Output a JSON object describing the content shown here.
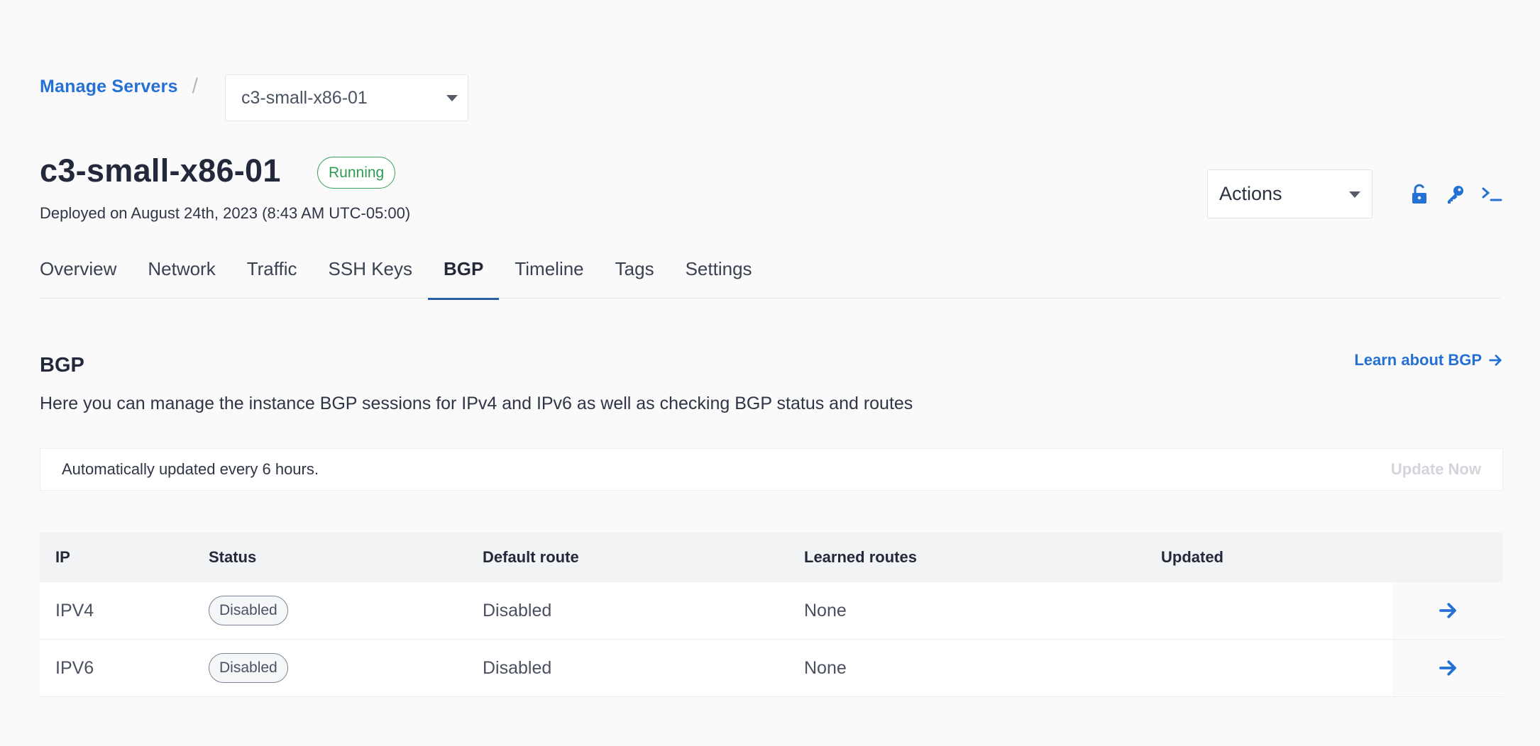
{
  "breadcrumb": {
    "link": "Manage Servers",
    "separator": "/",
    "server_select": "c3-small-x86-01"
  },
  "header": {
    "title": "c3-small-x86-01",
    "status": "Running",
    "deployed": "Deployed on August 24th, 2023 (8:43 AM UTC-05:00)",
    "actions": "Actions"
  },
  "toolbar": {
    "icons": [
      "unlock-icon",
      "key-icon",
      "terminal-icon"
    ]
  },
  "tabs": [
    {
      "label": "Overview",
      "active": false
    },
    {
      "label": "Network",
      "active": false
    },
    {
      "label": "Traffic",
      "active": false
    },
    {
      "label": "SSH Keys",
      "active": false
    },
    {
      "label": "BGP",
      "active": true
    },
    {
      "label": "Timeline",
      "active": false
    },
    {
      "label": "Tags",
      "active": false
    },
    {
      "label": "Settings",
      "active": false
    }
  ],
  "section": {
    "title": "BGP",
    "learn_link": "Learn about BGP",
    "description": "Here you can manage the instance BGP sessions for IPv4 and IPv6 as well as checking BGP status and routes"
  },
  "notice": {
    "text": "Automatically updated every 6 hours.",
    "button": "Update Now"
  },
  "table": {
    "columns": [
      "IP",
      "Status",
      "Default route",
      "Learned routes",
      "Updated"
    ],
    "rows": [
      {
        "ip": "IPV4",
        "status": "Disabled",
        "default_route": "Disabled",
        "learned_routes": "None",
        "updated": ""
      },
      {
        "ip": "IPV6",
        "status": "Disabled",
        "default_route": "Disabled",
        "learned_routes": "None",
        "updated": ""
      }
    ]
  },
  "colors": {
    "accent": "#2470d4",
    "running": "#2e9b50",
    "active_tab_underline": "#2a5fa8"
  }
}
